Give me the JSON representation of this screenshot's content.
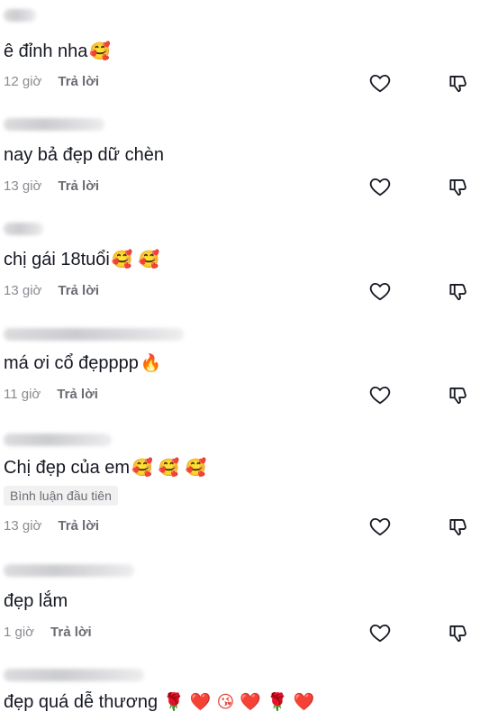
{
  "comments": [
    {
      "text": "ê đỉnh nha",
      "emoji": "🥰",
      "time": "12 giờ",
      "reply": "Trả lời"
    },
    {
      "text": "nay bả đẹp dữ chèn",
      "emoji": "",
      "time": "13 giờ",
      "reply": "Trả lời"
    },
    {
      "text": "chị gái 18tuổi",
      "emoji": "🥰 🥰",
      "time": "13 giờ",
      "reply": "Trả lời"
    },
    {
      "text": "má ơi cổ đẹpppp",
      "emoji": "🔥",
      "time": "11 giờ",
      "reply": "Trả lời"
    },
    {
      "text": "Chị đẹp của em",
      "emoji": "🥰 🥰 🥰",
      "badge": "Bình luận đầu tiên",
      "time": "13 giờ",
      "reply": "Trả lời"
    },
    {
      "text": "đẹp lắm",
      "emoji": "",
      "time": "1 giờ",
      "reply": "Trả lời"
    },
    {
      "text": "đẹp quá dễ thương",
      "emoji": "🌹 ❤️ 😘 ❤️ 🌹 ❤️"
    }
  ],
  "icons": {
    "like": "heart-outline-icon",
    "dislike": "thumbs-down-outline-icon"
  }
}
